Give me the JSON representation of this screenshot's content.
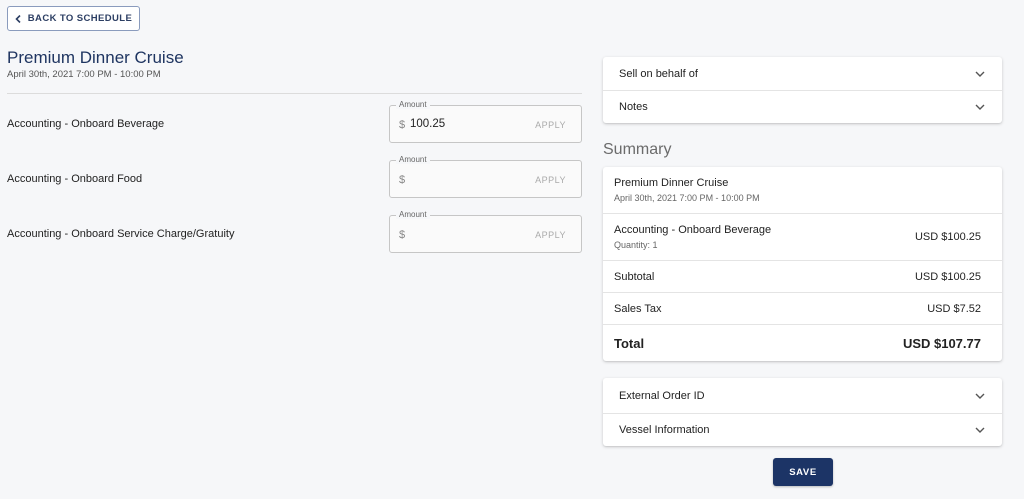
{
  "nav": {
    "back_label": "BACK TO SCHEDULE"
  },
  "event": {
    "title": "Premium Dinner Cruise",
    "datetime": "April 30th, 2021 7:00 PM - 10:00 PM"
  },
  "items": [
    {
      "label": "Accounting - Onboard Beverage",
      "amount_legend": "Amount",
      "currency": "$",
      "value": "100.25",
      "apply_label": "APPLY"
    },
    {
      "label": "Accounting - Onboard Food",
      "amount_legend": "Amount",
      "currency": "$",
      "value": "",
      "apply_label": "APPLY"
    },
    {
      "label": "Accounting - Onboard Service Charge/Gratuity",
      "amount_legend": "Amount",
      "currency": "$",
      "value": "",
      "apply_label": "APPLY"
    }
  ],
  "top_panels": [
    {
      "label": "Sell on behalf of",
      "icon": "chevron-down-icon"
    },
    {
      "label": "Notes",
      "icon": "chevron-down-icon"
    }
  ],
  "summary": {
    "heading": "Summary",
    "event_title": "Premium Dinner Cruise",
    "event_datetime": "April 30th, 2021 7:00 PM - 10:00 PM",
    "line_item": {
      "name": "Accounting - Onboard Beverage",
      "quantity": "Quantity: 1",
      "price": "USD $100.25"
    },
    "subtotal_label": "Subtotal",
    "subtotal_value": "USD $100.25",
    "tax_label": "Sales Tax",
    "tax_value": "USD $7.52",
    "total_label": "Total",
    "total_value": "USD $107.77"
  },
  "bottom_panels": [
    {
      "label": "External Order ID",
      "icon": "chevron-down-icon"
    },
    {
      "label": "Vessel Information",
      "icon": "chevron-down-icon"
    }
  ],
  "actions": {
    "save_label": "SAVE"
  },
  "colors": {
    "primary": "#1c3466",
    "title": "#1f3561"
  }
}
